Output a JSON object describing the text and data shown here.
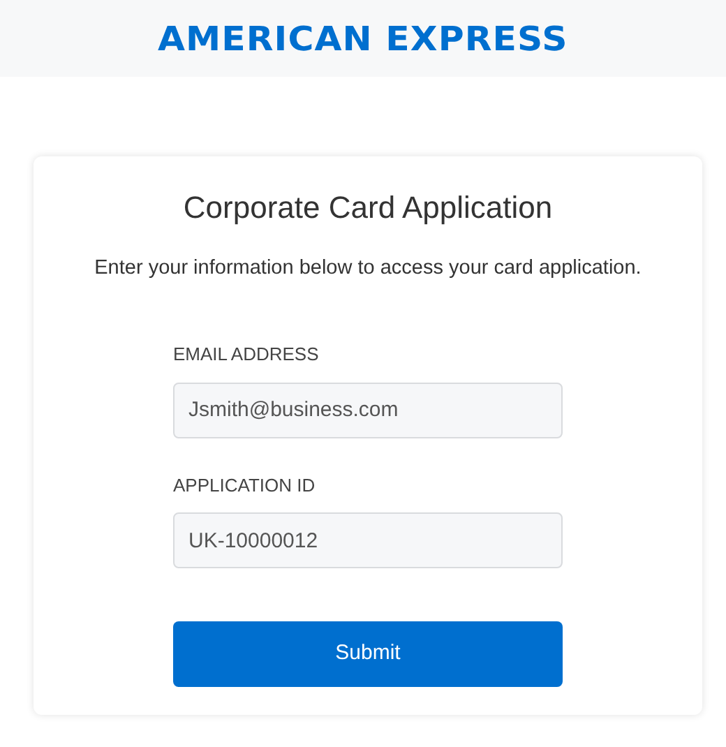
{
  "header": {
    "logo": "AMERICAN EXPRESS"
  },
  "card": {
    "title": "Corporate Card Application",
    "subtitle": "Enter your information below to access your card application.",
    "fields": [
      {
        "label": "EMAIL ADDRESS",
        "placeholder": "Jsmith@business.com"
      },
      {
        "label": "APPLICATION ID",
        "placeholder": "UK-10000012"
      }
    ],
    "submit": "Submit"
  }
}
